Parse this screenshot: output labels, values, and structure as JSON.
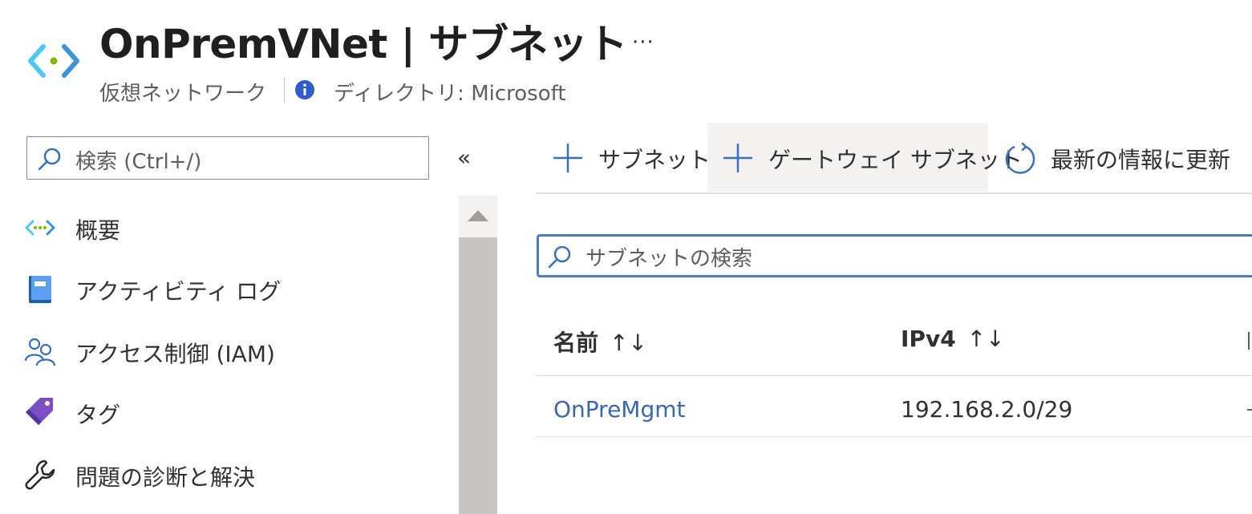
{
  "header": {
    "title": "OnPremVNet | サブネット",
    "more_label": "···",
    "resource_type": "仮想ネットワーク",
    "directory": "ディレクトリ: Microsoft",
    "logo_icon": "virtual-network-icon",
    "info_icon": "info-icon"
  },
  "sidebar": {
    "search_placeholder": "検索 (Ctrl+/)",
    "collapse_label": "«",
    "items": [
      {
        "label": "概要",
        "icon": "virtual-network-overview-icon"
      },
      {
        "label": "アクティビティ ログ",
        "icon": "activity-log-icon"
      },
      {
        "label": "アクセス制御 (IAM)",
        "icon": "people-icon"
      },
      {
        "label": "タグ",
        "icon": "tag-icon"
      },
      {
        "label": "問題の診断と解決",
        "icon": "wrench-icon"
      }
    ]
  },
  "toolbar": {
    "add_subnet_label": "サブネット",
    "add_gateway_subnet_label": "ゲートウェイ サブネット",
    "refresh_label": "最新の情報に更新"
  },
  "subnet_search": {
    "placeholder": "サブネットの検索"
  },
  "table": {
    "columns": [
      {
        "label": "名前",
        "sort": "↑↓"
      },
      {
        "label": "IPv4",
        "sort": "↑↓"
      }
    ],
    "rows": [
      {
        "name": "OnPreMgmt",
        "ipv4": "192.168.2.0/29"
      }
    ]
  },
  "colors": {
    "accent": "#4a7ec2",
    "link": "#3a67ad",
    "text": "#323130",
    "muted": "#605e5c",
    "info_blue": "#2d5cc6",
    "vnet_green": "#7fba00",
    "vnet_blue": "#50c7f2",
    "tag_purple": "#7b4fc2"
  }
}
